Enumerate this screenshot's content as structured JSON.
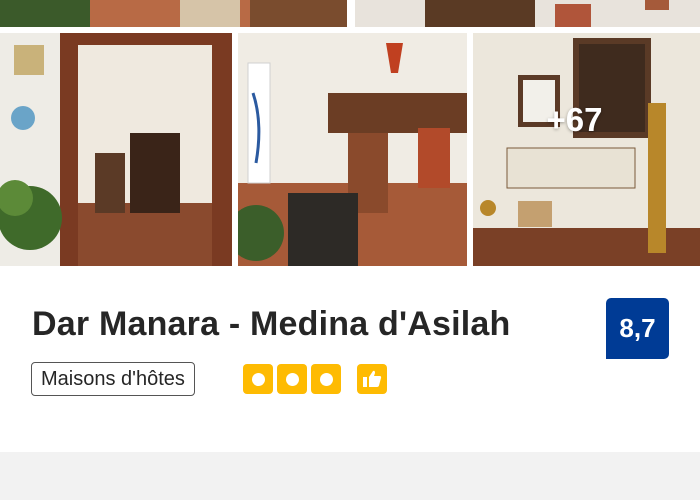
{
  "gallery": {
    "more_photos_label": "+67"
  },
  "property": {
    "name": "Dar Manara - Medina d'Asilah",
    "type": "Maisons d'hôtes",
    "rating_score": "8,7",
    "quality_dots": 3,
    "quality_icon": "thumbs-up-icon"
  },
  "colors": {
    "score_bg": "#003b95",
    "quality_yellow": "#febb02",
    "title_text": "#262626"
  }
}
